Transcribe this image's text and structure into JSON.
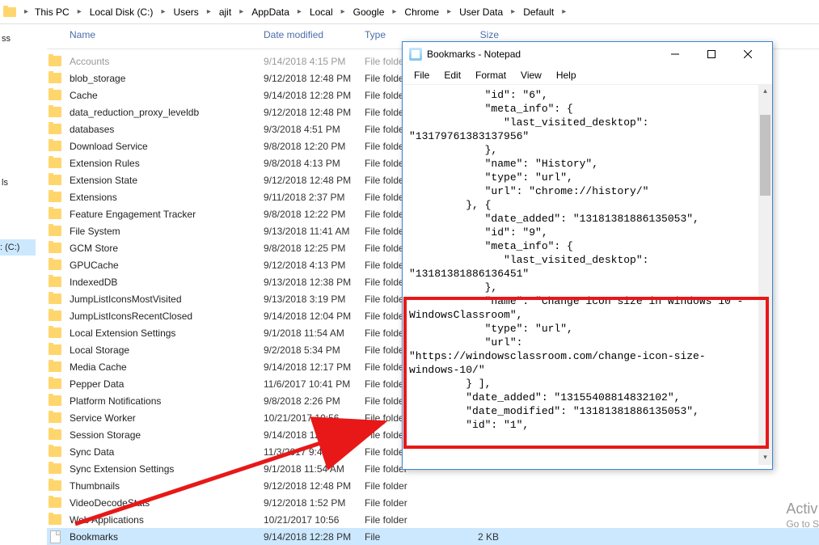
{
  "breadcrumb": {
    "items": [
      "This PC",
      "Local Disk (C:)",
      "Users",
      "ajit",
      "AppData",
      "Local",
      "Google",
      "Chrome",
      "User Data",
      "Default"
    ]
  },
  "leftnav": {
    "fragmentTop": "ss",
    "fragmentMid": "ls",
    "selectedLabel": ": (C:)"
  },
  "columns": {
    "name": "Name",
    "date": "Date modified",
    "type": "Type",
    "size": "Size"
  },
  "rows": [
    {
      "name": "Accounts",
      "date": "9/14/2018 4:15 PM",
      "type": "File folder",
      "size": "",
      "kind": "folder",
      "dim": true
    },
    {
      "name": "blob_storage",
      "date": "9/12/2018 12:48 PM",
      "type": "File folder",
      "size": "",
      "kind": "folder"
    },
    {
      "name": "Cache",
      "date": "9/14/2018 12:28 PM",
      "type": "File folder",
      "size": "",
      "kind": "folder"
    },
    {
      "name": "data_reduction_proxy_leveldb",
      "date": "9/12/2018 12:48 PM",
      "type": "File folder",
      "size": "",
      "kind": "folder"
    },
    {
      "name": "databases",
      "date": "9/3/2018 4:51 PM",
      "type": "File folder",
      "size": "",
      "kind": "folder"
    },
    {
      "name": "Download Service",
      "date": "9/8/2018 12:20 PM",
      "type": "File folder",
      "size": "",
      "kind": "folder"
    },
    {
      "name": "Extension Rules",
      "date": "9/8/2018 4:13 PM",
      "type": "File folder",
      "size": "",
      "kind": "folder"
    },
    {
      "name": "Extension State",
      "date": "9/12/2018 12:48 PM",
      "type": "File folder",
      "size": "",
      "kind": "folder"
    },
    {
      "name": "Extensions",
      "date": "9/11/2018 2:37 PM",
      "type": "File folder",
      "size": "",
      "kind": "folder"
    },
    {
      "name": "Feature Engagement Tracker",
      "date": "9/8/2018 12:22 PM",
      "type": "File folder",
      "size": "",
      "kind": "folder"
    },
    {
      "name": "File System",
      "date": "9/13/2018 11:41 AM",
      "type": "File folder",
      "size": "",
      "kind": "folder"
    },
    {
      "name": "GCM Store",
      "date": "9/8/2018 12:25 PM",
      "type": "File folder",
      "size": "",
      "kind": "folder"
    },
    {
      "name": "GPUCache",
      "date": "9/12/2018 4:13 PM",
      "type": "File folder",
      "size": "",
      "kind": "folder"
    },
    {
      "name": "IndexedDB",
      "date": "9/13/2018 12:38 PM",
      "type": "File folder",
      "size": "",
      "kind": "folder"
    },
    {
      "name": "JumpListIconsMostVisited",
      "date": "9/13/2018 3:19 PM",
      "type": "File folder",
      "size": "",
      "kind": "folder"
    },
    {
      "name": "JumpListIconsRecentClosed",
      "date": "9/14/2018 12:04 PM",
      "type": "File folder",
      "size": "",
      "kind": "folder"
    },
    {
      "name": "Local Extension Settings",
      "date": "9/1/2018 11:54 AM",
      "type": "File folder",
      "size": "",
      "kind": "folder"
    },
    {
      "name": "Local Storage",
      "date": "9/2/2018 5:34 PM",
      "type": "File folder",
      "size": "",
      "kind": "folder"
    },
    {
      "name": "Media Cache",
      "date": "9/14/2018 12:17 PM",
      "type": "File folder",
      "size": "",
      "kind": "folder"
    },
    {
      "name": "Pepper Data",
      "date": "11/6/2017 10:41 PM",
      "type": "File folder",
      "size": "",
      "kind": "folder"
    },
    {
      "name": "Platform Notifications",
      "date": "9/8/2018 2:26 PM",
      "type": "File folder",
      "size": "",
      "kind": "folder"
    },
    {
      "name": "Service Worker",
      "date": "10/21/2017 10:56",
      "type": "File folder",
      "size": "",
      "kind": "folder"
    },
    {
      "name": "Session Storage",
      "date": "9/14/2018 12:28 PM",
      "type": "File folder",
      "size": "",
      "kind": "folder"
    },
    {
      "name": "Sync Data",
      "date": "11/3/2017 9:47 PM",
      "type": "File folder",
      "size": "",
      "kind": "folder"
    },
    {
      "name": "Sync Extension Settings",
      "date": "9/1/2018 11:54 AM",
      "type": "File folder",
      "size": "",
      "kind": "folder"
    },
    {
      "name": "Thumbnails",
      "date": "9/12/2018 12:48 PM",
      "type": "File folder",
      "size": "",
      "kind": "folder"
    },
    {
      "name": "VideoDecodeStats",
      "date": "9/12/2018 1:52 PM",
      "type": "File folder",
      "size": "",
      "kind": "folder"
    },
    {
      "name": "Web Applications",
      "date": "10/21/2017 10:56",
      "type": "File folder",
      "size": "",
      "kind": "folder"
    },
    {
      "name": "Bookmarks",
      "date": "9/14/2018 12:28 PM",
      "type": "File",
      "size": "2 KB",
      "kind": "file",
      "selected": true
    }
  ],
  "notepad": {
    "title": "Bookmarks - Notepad",
    "menu": [
      "File",
      "Edit",
      "Format",
      "View",
      "Help"
    ],
    "content": "            \"id\": \"6\",\n            \"meta_info\": {\n               \"last_visited_desktop\":\n\"13179761383137956\"\n            },\n            \"name\": \"History\",\n            \"type\": \"url\",\n            \"url\": \"chrome://history/\"\n         }, {\n            \"date_added\": \"13181381886135053\",\n            \"id\": \"9\",\n            \"meta_info\": {\n               \"last_visited_desktop\":\n\"13181381886136451\"\n            },\n            \"name\": \"Change icon size in windows 10 -\nWindowsClassroom\",\n            \"type\": \"url\",\n            \"url\":\n\"https://windowsclassroom.com/change-icon-size-\nwindows-10/\"\n         } ],\n         \"date_added\": \"13155408814832102\",\n         \"date_modified\": \"13181381886135053\",\n         \"id\": \"1\","
  },
  "watermark": {
    "line1": "Activ",
    "line2": "Go to S"
  }
}
